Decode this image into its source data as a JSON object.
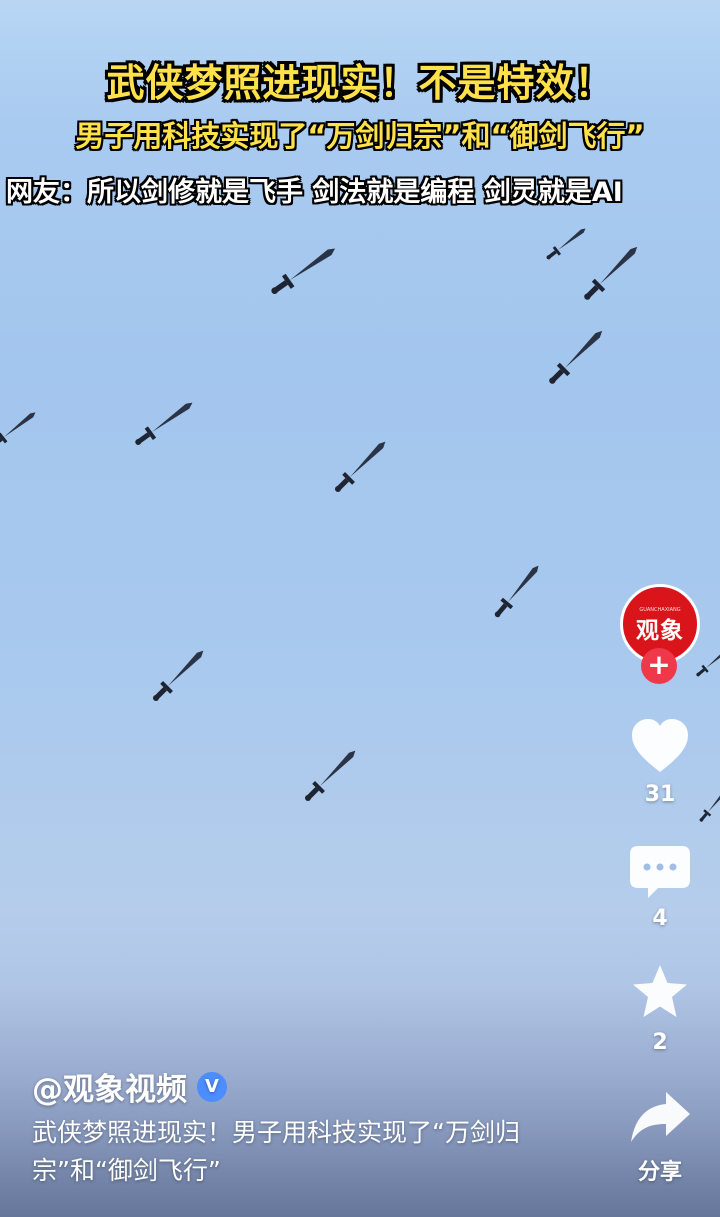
{
  "overlay": {
    "title": "武侠梦照进现实！不是特效！",
    "subtitle": "男子用科技实现了“万剑归宗”和“御剑飞行”",
    "comment": "网友：所以剑修就是飞手 剑法就是编程 剑灵就是AI"
  },
  "channel": {
    "avatar_text": "观象",
    "avatar_small": "GUANCHAXIANG"
  },
  "actions": {
    "likes": "31",
    "comments": "4",
    "favorites": "2",
    "share_label": "分享"
  },
  "post": {
    "author": "@观象视频",
    "verified_badge": "V",
    "caption": "武侠梦照进现实！男子用科技实现了“万剑归宗”和“御剑飞行”"
  },
  "colors": {
    "title_yellow": "#ffe14a",
    "avatar_red": "#d9141b",
    "follow_red": "#f0384b",
    "verified_blue": "#4c8dff"
  },
  "icons": [
    "sword-icon",
    "heart-icon",
    "comment-icon",
    "star-icon",
    "share-icon",
    "plus-icon"
  ]
}
